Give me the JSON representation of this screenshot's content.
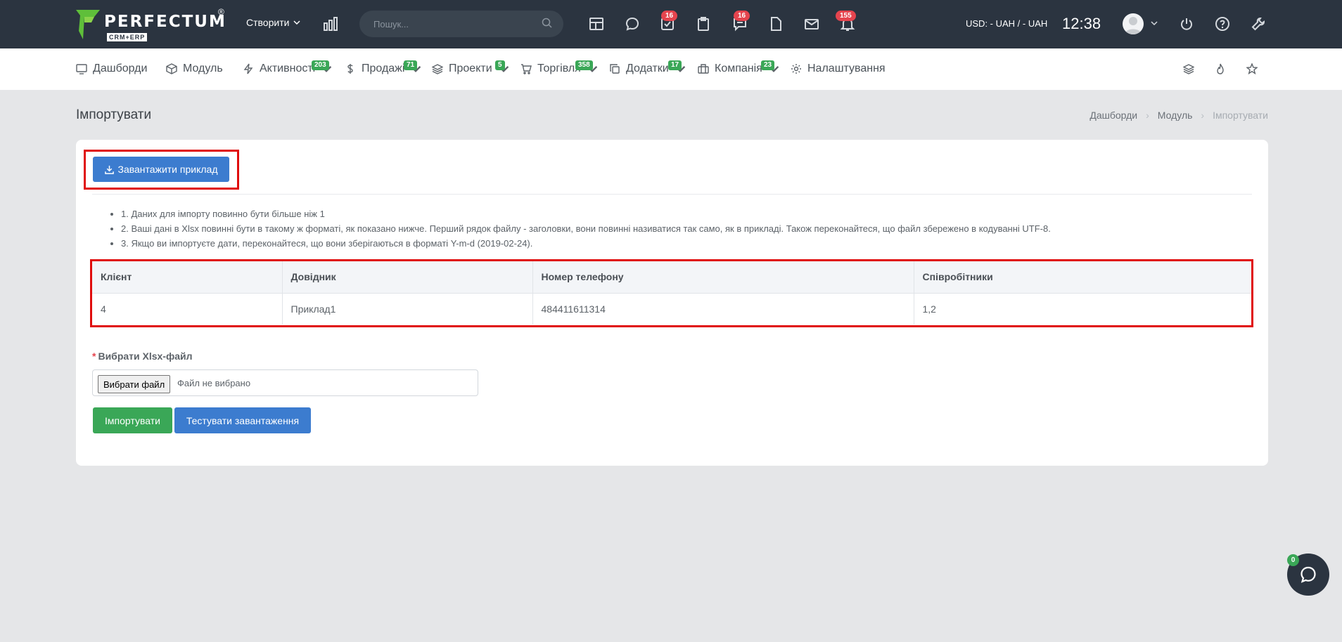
{
  "header": {
    "logo_text": "PERFECTUM",
    "logo_reg": "®",
    "logo_sub": "CRM+ERP",
    "create_label": "Створити",
    "search_placeholder": "Пошук...",
    "badges": {
      "tasks": "16",
      "messages": "16",
      "notifications": "155"
    },
    "currency": "USD: - UAH / - UAH",
    "time": "12:38"
  },
  "nav": {
    "items": [
      {
        "label": "Дашборди",
        "icon": "monitor-icon"
      },
      {
        "label": "Модуль",
        "icon": "cube-icon"
      },
      {
        "label": "Активності",
        "icon": "bolt-icon",
        "badge": "203"
      },
      {
        "label": "Продажі",
        "icon": "dollar-icon",
        "badge": "71"
      },
      {
        "label": "Проекти",
        "icon": "layers-icon",
        "badge": "5"
      },
      {
        "label": "Торгівля",
        "icon": "cart-icon",
        "badge": "358"
      },
      {
        "label": "Додатки",
        "icon": "copy-icon",
        "badge": "17"
      },
      {
        "label": "Компанія",
        "icon": "briefcase-icon",
        "badge": "23"
      },
      {
        "label": "Налаштування",
        "icon": "gear-icon"
      }
    ]
  },
  "page": {
    "title": "Імпортувати",
    "breadcrumb": [
      "Дашборди",
      "Модуль",
      "Імпортувати"
    ]
  },
  "import": {
    "download_label": "Завантажити приклад",
    "notes": [
      "1. Даних для імпорту повинно бути більше ніж 1",
      "2. Ваші дані в Xlsx повинні бути в такому ж форматі, як показано нижче. Перший рядок файлу - заголовки, вони повинні називатися так само, як в прикладі. Також переконайтеся, що файл збережено в кодуванні UTF-8.",
      "3. Якщо ви імпортуєте дати, переконайтеся, що вони зберігаються в форматі Y-m-d (2019-02-24)."
    ],
    "table": {
      "headers": [
        "Клієнт",
        "Довідник",
        "Номер телефону",
        "Співробітники"
      ],
      "row": [
        "4",
        "Приклад1",
        "484411611314",
        "1,2"
      ]
    },
    "file_label": "Вибрати Xlsx-файл",
    "required_mark": "*",
    "file_button": "Вибрати файл",
    "file_status": "Файл не вибрано",
    "import_label": "Імпортувати",
    "test_label": "Тестувати завантаження"
  },
  "chat": {
    "badge": "0"
  },
  "colors": {
    "topbar": "#2b3440",
    "primary": "#3c7ccf",
    "success": "#3aa757",
    "danger": "#e5444e",
    "highlight": "#e00d0d"
  }
}
